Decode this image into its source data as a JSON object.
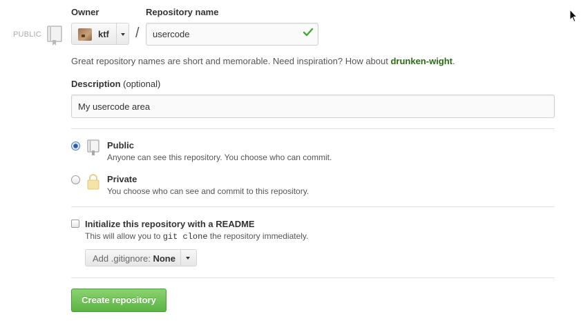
{
  "owner": {
    "label": "Owner",
    "name": "ktf"
  },
  "repository": {
    "label": "Repository name",
    "value": "usercode",
    "visibility_tag": "PUBLIC",
    "slash": "/"
  },
  "hint": {
    "text": "Great repository names are short and memorable. Need inspiration? How about ",
    "suggestion": "drunken-wight",
    "end": "."
  },
  "description": {
    "label": "Description",
    "optional": "(optional)",
    "value": "My usercode area"
  },
  "visibility": {
    "public": {
      "title": "Public",
      "subtitle": "Anyone can see this repository. You choose who can commit.",
      "selected": true
    },
    "private": {
      "title": "Private",
      "subtitle": "You choose who can see and commit to this repository.",
      "selected": false
    }
  },
  "readme": {
    "label": "Initialize this repository with a README",
    "sub_before": "This will allow you to ",
    "sub_code": "git clone",
    "sub_after": " the repository immediately.",
    "checked": false
  },
  "gitignore": {
    "prefix": "Add .gitignore:",
    "value": "None"
  },
  "create_button": "Create repository",
  "colors": {
    "accent_green": "#5bb443",
    "suggestion_green": "#2c6b15",
    "check_green": "#3cab29"
  }
}
